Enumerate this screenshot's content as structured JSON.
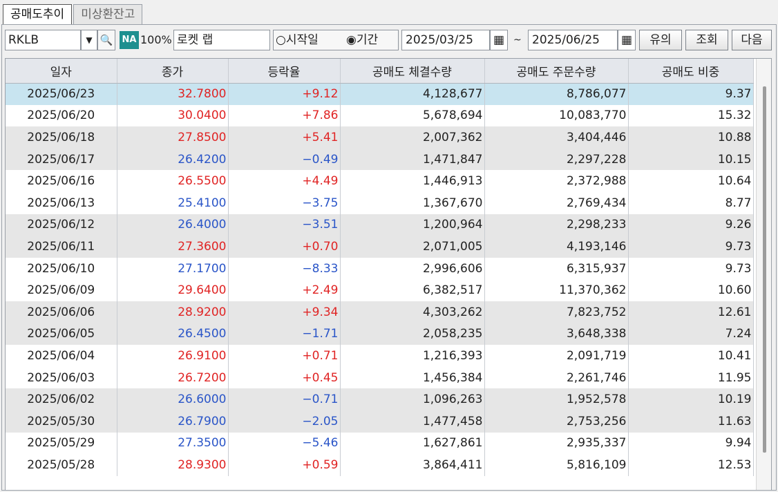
{
  "tabs": [
    "공매도추이",
    "미상환잔고"
  ],
  "toolbar": {
    "code": "RKLB",
    "badge": "NA",
    "margin_pct": "100%",
    "stock_name": "로켓 랩",
    "radio_start": "○시작일",
    "radio_period": "◉기간",
    "date_from": "2025/03/25",
    "tilde": "~",
    "date_to": "2025/06/25",
    "btn_caution": "유의",
    "btn_query": "조회",
    "btn_next": "다음"
  },
  "columns": [
    "일자",
    "종가",
    "등락율",
    "공매도 체결수량",
    "공매도 주문수량",
    "공매도 비중"
  ],
  "rows": [
    {
      "date": "2025/06/23",
      "close": "32.7800",
      "change": "+9.12",
      "exec": "4,128,677",
      "order": "8,786,077",
      "ratio": "9.37",
      "dir": "up"
    },
    {
      "date": "2025/06/20",
      "close": "30.0400",
      "change": "+7.86",
      "exec": "5,678,694",
      "order": "10,083,770",
      "ratio": "15.32",
      "dir": "up"
    },
    {
      "date": "2025/06/18",
      "close": "27.8500",
      "change": "+5.41",
      "exec": "2,007,362",
      "order": "3,404,446",
      "ratio": "10.88",
      "dir": "up"
    },
    {
      "date": "2025/06/17",
      "close": "26.4200",
      "change": "-0.49",
      "exec": "1,471,847",
      "order": "2,297,228",
      "ratio": "10.15",
      "dir": "down"
    },
    {
      "date": "2025/06/16",
      "close": "26.5500",
      "change": "+4.49",
      "exec": "1,446,913",
      "order": "2,372,988",
      "ratio": "10.64",
      "dir": "up"
    },
    {
      "date": "2025/06/13",
      "close": "25.4100",
      "change": "-3.75",
      "exec": "1,367,670",
      "order": "2,769,434",
      "ratio": "8.77",
      "dir": "down"
    },
    {
      "date": "2025/06/12",
      "close": "26.4000",
      "change": "-3.51",
      "exec": "1,200,964",
      "order": "2,298,233",
      "ratio": "9.26",
      "dir": "down"
    },
    {
      "date": "2025/06/11",
      "close": "27.3600",
      "change": "+0.70",
      "exec": "2,071,005",
      "order": "4,193,146",
      "ratio": "9.73",
      "dir": "up"
    },
    {
      "date": "2025/06/10",
      "close": "27.1700",
      "change": "-8.33",
      "exec": "2,996,606",
      "order": "6,315,937",
      "ratio": "9.73",
      "dir": "down"
    },
    {
      "date": "2025/06/09",
      "close": "29.6400",
      "change": "+2.49",
      "exec": "6,382,517",
      "order": "11,370,362",
      "ratio": "10.60",
      "dir": "up"
    },
    {
      "date": "2025/06/06",
      "close": "28.9200",
      "change": "+9.34",
      "exec": "4,303,262",
      "order": "7,823,752",
      "ratio": "12.61",
      "dir": "up"
    },
    {
      "date": "2025/06/05",
      "close": "26.4500",
      "change": "-1.71",
      "exec": "2,058,235",
      "order": "3,648,338",
      "ratio": "7.24",
      "dir": "down"
    },
    {
      "date": "2025/06/04",
      "close": "26.9100",
      "change": "+0.71",
      "exec": "1,216,393",
      "order": "2,091,719",
      "ratio": "10.41",
      "dir": "up"
    },
    {
      "date": "2025/06/03",
      "close": "26.7200",
      "change": "+0.45",
      "exec": "1,456,384",
      "order": "2,261,746",
      "ratio": "11.95",
      "dir": "up"
    },
    {
      "date": "2025/06/02",
      "close": "26.6000",
      "change": "-0.71",
      "exec": "1,096,263",
      "order": "1,952,578",
      "ratio": "10.19",
      "dir": "down"
    },
    {
      "date": "2025/05/30",
      "close": "26.7900",
      "change": "-2.05",
      "exec": "1,477,458",
      "order": "2,753,256",
      "ratio": "11.63",
      "dir": "down"
    },
    {
      "date": "2025/05/29",
      "close": "27.3500",
      "change": "-5.46",
      "exec": "1,627,861",
      "order": "2,935,337",
      "ratio": "9.94",
      "dir": "down"
    },
    {
      "date": "2025/05/28",
      "close": "28.9300",
      "change": "+0.59",
      "exec": "3,864,411",
      "order": "5,816,109",
      "ratio": "12.53",
      "dir": "up"
    }
  ],
  "colors": {
    "up": "#e02424",
    "down": "#2a55c8",
    "selected": "#c8e4f0",
    "band": "#e6e6e6"
  }
}
